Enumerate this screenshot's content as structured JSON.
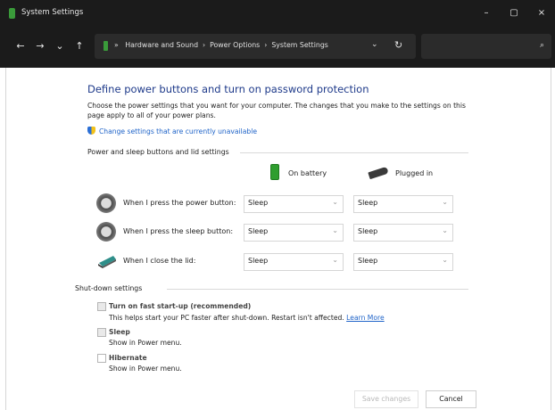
{
  "window": {
    "title": "System Settings",
    "buttons": {
      "minimize": "–",
      "maximize": "▢",
      "close": "×"
    }
  },
  "address_bar": {
    "back": "←",
    "forward": "→",
    "recent": "⌄",
    "up": "↑",
    "chevron_start": "»",
    "crumbs": [
      "Hardware and Sound",
      "Power Options",
      "System Settings"
    ],
    "separator": "›",
    "dropdown": "⌄",
    "refresh": "↻",
    "search_icon": "⌕"
  },
  "page": {
    "heading": "Define power buttons and turn on password protection",
    "description": "Choose the power settings that you want for your computer. The changes that you make to the settings on this page apply to all of your power plans.",
    "change_link": "Change settings that are currently unavailable",
    "power_section_label": "Power and sleep buttons and lid settings",
    "columns": {
      "battery": "On battery",
      "plugged": "Plugged in"
    },
    "rows": [
      {
        "label": "When I press the power button:",
        "battery": "Sleep",
        "plugged": "Sleep",
        "icon": "power-button-icon"
      },
      {
        "label": "When I press the sleep button:",
        "battery": "Sleep",
        "plugged": "Sleep",
        "icon": "sleep-button-icon"
      },
      {
        "label": "When I close the lid:",
        "battery": "Sleep",
        "plugged": "Sleep",
        "icon": "laptop-lid-icon"
      }
    ],
    "shutdown_section_label": "Shut-down settings",
    "shutdown_options": [
      {
        "label": "Turn on fast start-up (recommended)",
        "desc": "This helps start your PC faster after shut-down. Restart isn't affected.",
        "link": "Learn More"
      },
      {
        "label": "Sleep",
        "desc": "Show in Power menu."
      },
      {
        "label": "Hibernate",
        "desc": "Show in Power menu."
      }
    ],
    "save_label": "Save changes",
    "cancel_label": "Cancel"
  },
  "colors": {
    "title_bar": "#1b1b1b",
    "heading": "#1e3a8a",
    "link": "#1e63c8",
    "battery_green": "#2f9e2f"
  }
}
